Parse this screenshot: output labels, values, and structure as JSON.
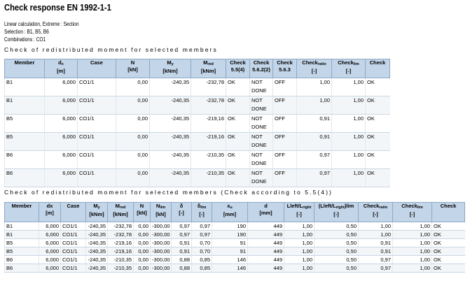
{
  "page": {
    "title": "Check response EN 1992-1-1",
    "info": [
      "Linear calculation, Extreme : Section",
      "Selection : B1, B5, B6",
      "Combinations : CO1"
    ]
  },
  "table1": {
    "heading": "Check of redistributed moment for selected members",
    "headers": [
      {
        "main": "Member",
        "sub": "",
        "unit": ""
      },
      {
        "main": "d",
        "sub": "x",
        "unit": "[m]"
      },
      {
        "main": "Case",
        "sub": "",
        "unit": ""
      },
      {
        "main": "N",
        "sub": "",
        "unit": "[kN]"
      },
      {
        "main": "M",
        "sub": "y",
        "unit": "[kNm]"
      },
      {
        "main": "M",
        "sub": "red",
        "unit": "[kNm]"
      },
      {
        "main": "Check",
        "sub": "",
        "unit": "5.5(4)"
      },
      {
        "main": "Check",
        "sub": "",
        "unit": "5.6.2(2)"
      },
      {
        "main": "Check",
        "sub": "",
        "unit": "5.6.3"
      },
      {
        "main": "Check",
        "sub": "ratio",
        "unit": "[-]"
      },
      {
        "main": "Check",
        "sub": "lim",
        "unit": "[-]"
      },
      {
        "main": "Check",
        "sub": "",
        "unit": ""
      }
    ],
    "rows": [
      [
        "B1",
        "6,000",
        "CO1/1",
        "0,00",
        "-240,35",
        "-232,78",
        "OK",
        "NOT DONE",
        "OFF",
        "1,00",
        "1,00",
        "OK"
      ],
      [
        "B1",
        "6,000",
        "CO1/1",
        "0,00",
        "-240,35",
        "-232,78",
        "OK",
        "NOT DONE",
        "OFF",
        "1,00",
        "1,00",
        "OK"
      ],
      [
        "B5",
        "6,000",
        "CO1/1",
        "0,00",
        "-240,35",
        "-219,16",
        "OK",
        "NOT DONE",
        "OFF",
        "0,91",
        "1,00",
        "OK"
      ],
      [
        "B5",
        "6,000",
        "CO1/1",
        "0,00",
        "-240,35",
        "-219,16",
        "OK",
        "NOT DONE",
        "OFF",
        "0,91",
        "1,00",
        "OK"
      ],
      [
        "B6",
        "6,000",
        "CO1/1",
        "0,00",
        "-240,35",
        "-210,35",
        "OK",
        "NOT DONE",
        "OFF",
        "0,97",
        "1,00",
        "OK"
      ],
      [
        "B6",
        "6,000",
        "CO1/1",
        "0,00",
        "-240,35",
        "-210,35",
        "OK",
        "NOT DONE",
        "OFF",
        "0,97",
        "1,00",
        "OK"
      ]
    ]
  },
  "table2": {
    "heading": "Check of redistributed moment for selected members (Check according to 5.5(4))",
    "headers": [
      {
        "main": "Member",
        "sub": "",
        "unit": ""
      },
      {
        "main": "dx",
        "sub": "",
        "unit": "[m]"
      },
      {
        "main": "Case",
        "sub": "",
        "unit": ""
      },
      {
        "main": "M",
        "sub": "y",
        "unit": "[kNm]"
      },
      {
        "main": "M",
        "sub": "red",
        "unit": "[kNm]"
      },
      {
        "main": "N",
        "sub": "",
        "unit": "[kN]"
      },
      {
        "main": "N",
        "sub": "lim",
        "unit": "[kN]"
      },
      {
        "main": "δ",
        "sub": "",
        "unit": "[-]"
      },
      {
        "main": "δ",
        "sub": "lim",
        "unit": "[-]"
      },
      {
        "main": "x",
        "sub": "u",
        "unit": "[mm]"
      },
      {
        "main": "d",
        "sub": "",
        "unit": "[mm]"
      },
      {
        "main": "Lleft/L",
        "sub": "right",
        "unit": "[-]"
      },
      {
        "main": "(Lleft/L",
        "sub": "right",
        "unit": "[-]",
        "tail": ")lim"
      },
      {
        "main": "Check",
        "sub": "ratio",
        "unit": "[-]"
      },
      {
        "main": "Check",
        "sub": "lim",
        "unit": "[-]"
      },
      {
        "main": "Check",
        "sub": "",
        "unit": ""
      }
    ],
    "rows": [
      [
        "B1",
        "6,000",
        "CO1/1",
        "-240,35",
        "-232,78",
        "0,00",
        "-300,00",
        "0,97",
        "0,97",
        "190",
        "449",
        "1,00",
        "0,50",
        "1,00",
        "1,00",
        "OK"
      ],
      [
        "B1",
        "6,000",
        "CO1/1",
        "-240,35",
        "-232,78",
        "0,00",
        "-300,00",
        "0,97",
        "0,97",
        "190",
        "449",
        "1,00",
        "0,50",
        "1,00",
        "1,00",
        "OK"
      ],
      [
        "B5",
        "6,000",
        "CO1/1",
        "-240,35",
        "-219,16",
        "0,00",
        "-300,00",
        "0,91",
        "0,70",
        "91",
        "449",
        "1,00",
        "0,50",
        "0,91",
        "1,00",
        "OK"
      ],
      [
        "B5",
        "6,000",
        "CO1/1",
        "-240,35",
        "-219,16",
        "0,00",
        "-300,00",
        "0,91",
        "0,70",
        "91",
        "449",
        "1,00",
        "0,50",
        "0,91",
        "1,00",
        "OK"
      ],
      [
        "B6",
        "6,000",
        "CO1/1",
        "-240,35",
        "-210,35",
        "0,00",
        "-300,00",
        "0,88",
        "0,85",
        "146",
        "449",
        "1,00",
        "0,50",
        "0,97",
        "1,00",
        "OK"
      ],
      [
        "B6",
        "6,000",
        "CO1/1",
        "-240,35",
        "-210,35",
        "0,00",
        "-300,00",
        "0,88",
        "0,85",
        "146",
        "449",
        "1,00",
        "0,50",
        "0,97",
        "1,00",
        "OK"
      ]
    ]
  }
}
